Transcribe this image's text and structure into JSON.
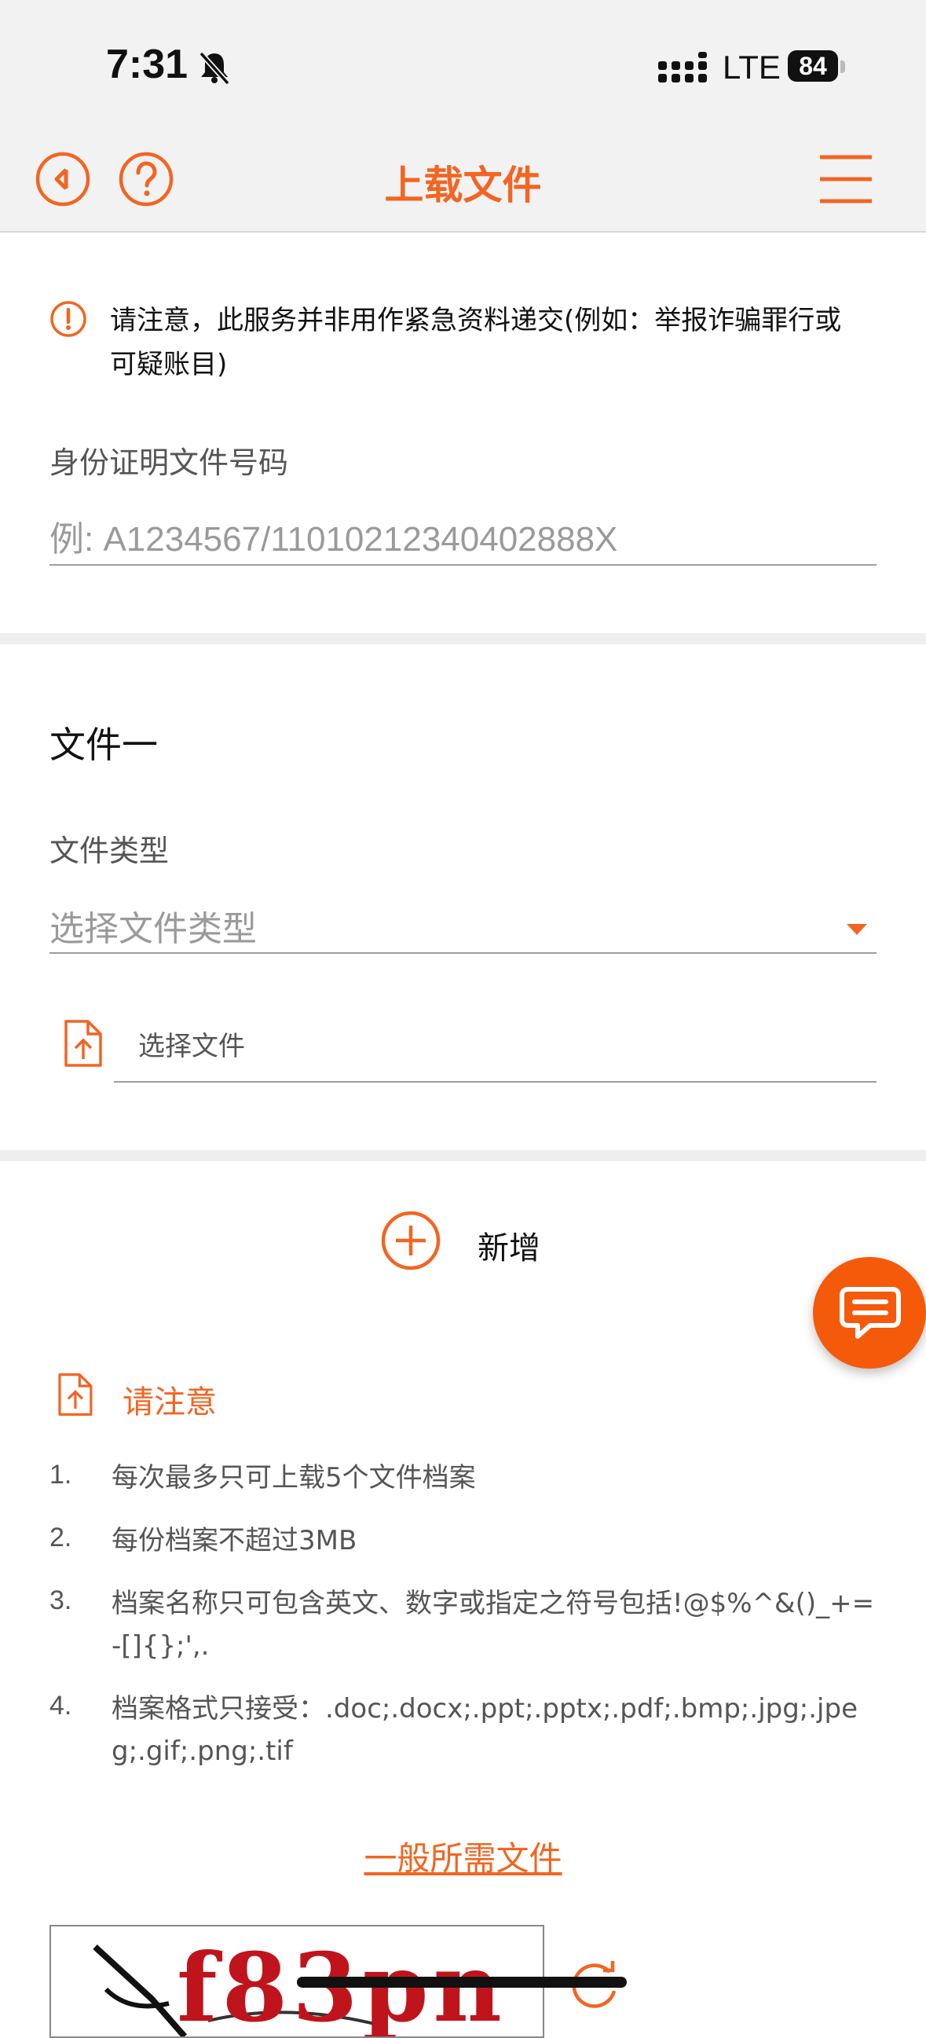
{
  "status_bar": {
    "time": "7:31",
    "network": "LTE",
    "battery": "84"
  },
  "header": {
    "title": "上载文件",
    "back_icon": "back-arrow-circle-icon",
    "help_icon": "question-circle-icon",
    "menu_icon": "hamburger-menu-icon"
  },
  "notice": {
    "text": "请注意，此服务并非用作紧急资料递交(例如：举报诈骗罪行或可疑账目)"
  },
  "id_field": {
    "label": "身份证明文件号码",
    "placeholder": "例: A1234567/11010212340402888X"
  },
  "document": {
    "title": "文件一",
    "type_label": "文件类型",
    "type_placeholder": "选择文件类型",
    "choose_file_label": "选择文件"
  },
  "add_button": {
    "label": "新增"
  },
  "notes": {
    "title": "请注意",
    "items": [
      {
        "num": "1.",
        "text": "每次最多只可上载5个文件档案"
      },
      {
        "num": "2.",
        "text": "每份档案不超过3MB"
      },
      {
        "num": "3.",
        "text": "档案名称只可包含英文、数字或指定之符号包括!@$%^&()_+=-[]{};',."
      },
      {
        "num": "4.",
        "text": "档案格式只接受：.doc;.docx;.ppt;.pptx;.pdf;.bmp;.jpg;.jpeg;.gif;.png;.tif"
      }
    ]
  },
  "general_docs_link": "一般所需文件",
  "captcha": {
    "text": "f83pn"
  },
  "colors": {
    "accent": "#f26522",
    "chat_button": "#f55a0a",
    "bar_bg": "#f2f2f2"
  }
}
